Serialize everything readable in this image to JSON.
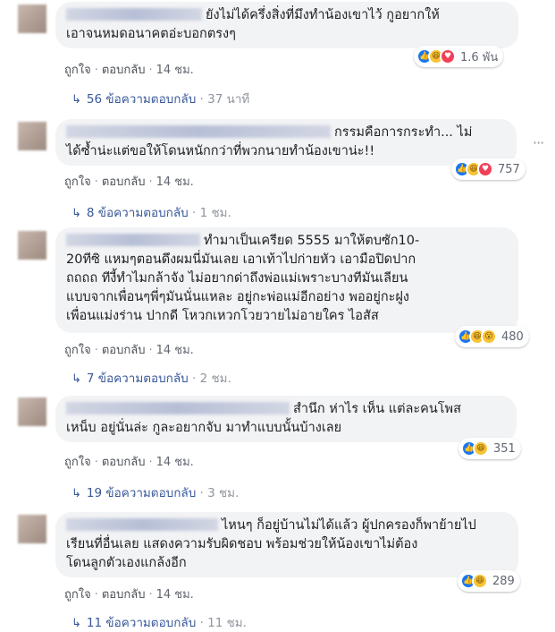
{
  "comments": [
    {
      "text": "ยังไม่ได้ครึ่งสิ่งที่มึงทำน้องเขาไว้ กูอยากให้\nเอาจนหมดอนาคตอ่ะบอกตรงๆ",
      "reactions": [
        "like",
        "haha",
        "love"
      ],
      "reaction_count": "1.6 พัน",
      "like_label": "ถูกใจ",
      "reply_label": "ตอบกลับ",
      "time": "14 ชม.",
      "replies_label": "56 ข้อความตอบกลับ",
      "replies_time": "37 นาที"
    },
    {
      "text": "กรรมคือการกระทำ... ไม่\nได้ซ้ำน่ะแต่ขอให้โดนหนักกว่าที่พวกนายทำน้องเขาน่ะ!!",
      "reactions": [
        "like",
        "haha",
        "love"
      ],
      "reaction_count": "757",
      "like_label": "ถูกใจ",
      "reply_label": "ตอบกลับ",
      "time": "14 ชม.",
      "replies_label": "8 ข้อความตอบกลับ",
      "replies_time": "1 ชม."
    },
    {
      "text": "ทำมาเป็นเครียด 5555 มาให้ตบซัก10-\n20ทีซิ แหมๆตอนดึงผมนี่มันเลย เอาเท้าไปก่ายหัว เอามือปิดปาก\nถถถถ ทีงี้ทำไมกล้าจัง ไม่อยากด่าถึงพ่อแม่เพราะบางทีมันเลียน\nแบบจากเพื่อนๆพี่ๆมันนั่นแหละ อยู่กะพ่อแม่อีกอย่าง พออยู่กะฝูง\nเพื่อนแม่งร่าน ปากดี โหวกเหวกโวยวายไม่อายใคร ไอสัส",
      "reactions": [
        "like",
        "haha",
        "wow"
      ],
      "reaction_count": "480",
      "like_label": "ถูกใจ",
      "reply_label": "ตอบกลับ",
      "time": "14 ชม.",
      "replies_label": "7 ข้อความตอบกลับ",
      "replies_time": "2 ชม."
    },
    {
      "text": "สำนึก ห่าไร เห็น แต่ละคนโพส\nเหน็บ อยู่นั่นล่ะ กูละอยากจับ มาทำแบบนั้นบ้างเลย",
      "reactions": [
        "like",
        "haha"
      ],
      "reaction_count": "351",
      "like_label": "ถูกใจ",
      "reply_label": "ตอบกลับ",
      "time": "14 ชม.",
      "replies_label": "19 ข้อความตอบกลับ",
      "replies_time": "3 ชม."
    },
    {
      "text": "ไหนๆ ก็อยู่บ้านไม่ได้แล้ว ผู้ปกครองก็พาย้ายไป\nเรียนที่อื่นเลย แสดงความรับผิดชอบ พร้อมช่วยให้น้องเขาไม่ต้อง\nโดนลูกตัวเองแกล้งอีก",
      "reactions": [
        "like",
        "haha"
      ],
      "reaction_count": "289",
      "like_label": "ถูกใจ",
      "reply_label": "ตอบกลับ",
      "time": "14 ชม.",
      "replies_label": "11 ข้อความตอบกลับ",
      "replies_time": "11 ชม."
    }
  ],
  "more_icon": "···"
}
